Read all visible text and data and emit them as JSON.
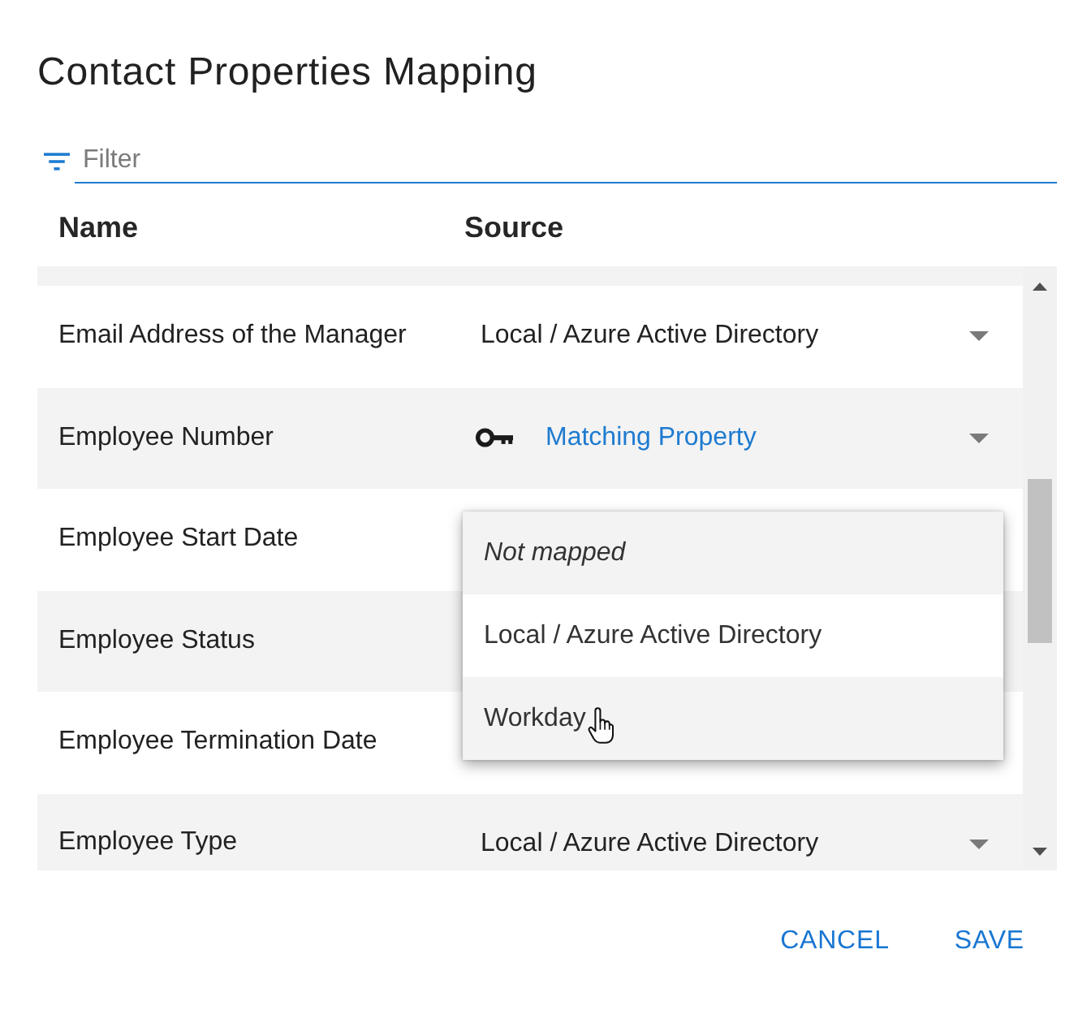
{
  "dialog": {
    "title": "Contact Properties Mapping"
  },
  "filter": {
    "placeholder": "Filter"
  },
  "table": {
    "columns": [
      "Name",
      "Source"
    ],
    "rows": [
      {
        "name": "Email Address of the Manager",
        "source": {
          "kind": "plain",
          "text": "Local / Azure Active Directory"
        }
      },
      {
        "name": "Employee Number",
        "source": {
          "kind": "matching",
          "text": "Matching Property"
        }
      },
      {
        "name": "Employee Start Date",
        "menu": [
          {
            "label": "Not mapped",
            "kind": "unmapped",
            "hovered": false
          },
          {
            "label": "Local / Azure Active Directory",
            "kind": "source",
            "hovered": false
          },
          {
            "label": "Workday",
            "kind": "source",
            "hovered": true
          }
        ]
      },
      {
        "name": "Employee Status"
      },
      {
        "name": "Employee Termination Date"
      },
      {
        "name": "Employee Type",
        "source": {
          "kind": "plain",
          "text": "Local / Azure Active Directory"
        }
      }
    ]
  },
  "buttons": [
    {
      "label": "CANCEL"
    },
    {
      "label": "SAVE"
    }
  ]
}
